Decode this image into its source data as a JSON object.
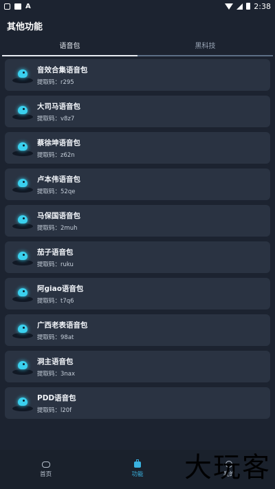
{
  "status_bar": {
    "time": "2:38"
  },
  "header": {
    "title": "其他功能"
  },
  "tabs": [
    {
      "label": "语音包",
      "active": true
    },
    {
      "label": "黑科技",
      "active": false
    }
  ],
  "items": [
    {
      "title": "音效合集语音包",
      "code": "提取码：r295"
    },
    {
      "title": "大司马语音包",
      "code": "提取码：v8z7"
    },
    {
      "title": "蔡徐坤语音包",
      "code": "提取码：z62n"
    },
    {
      "title": "卢本伟语音包",
      "code": "提取码：52qe"
    },
    {
      "title": "马保国语音包",
      "code": "提取码：2muh"
    },
    {
      "title": "茄子语音包",
      "code": "提取码：ruku"
    },
    {
      "title": "阿giao语音包",
      "code": "提取码：t7q6"
    },
    {
      "title": "广西老表语音包",
      "code": "提取码：98at"
    },
    {
      "title": "洞主语音包",
      "code": "提取码：3nax"
    },
    {
      "title": "PDD语音包",
      "code": "提取码：l20f"
    }
  ],
  "bottom_nav": [
    {
      "label": "首页",
      "icon": "gamepad-icon"
    },
    {
      "label": "功能",
      "icon": "briefcase-icon"
    },
    {
      "label": "我的",
      "icon": "user-icon"
    }
  ],
  "watermark": "大玩客",
  "colors": {
    "background": "#1c2330",
    "card": "#2a3342",
    "accent": "#3ab2e0"
  }
}
